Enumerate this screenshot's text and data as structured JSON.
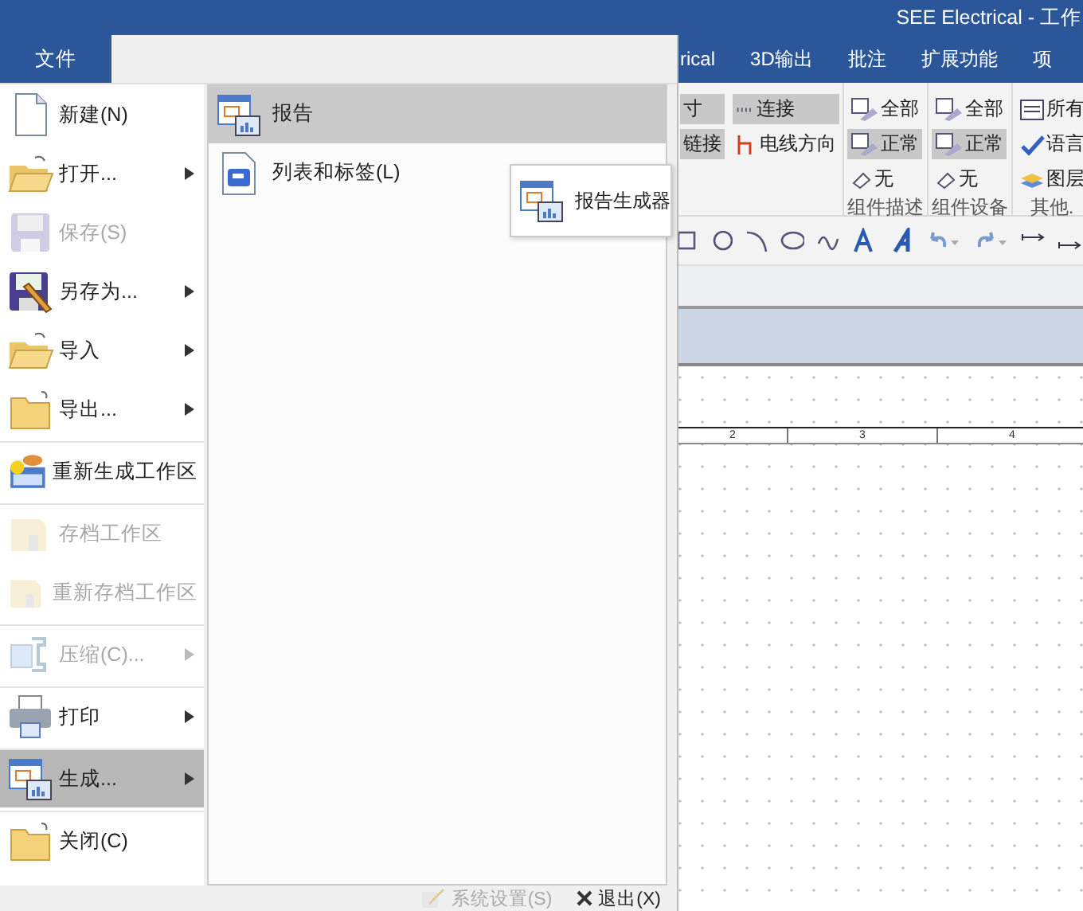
{
  "window": {
    "title": "SEE Electrical - 工作"
  },
  "ribbon_tabs": [
    {
      "label": "rical"
    },
    {
      "label": "3D输出"
    },
    {
      "label": "批注"
    },
    {
      "label": "扩展功能"
    },
    {
      "label": "项"
    }
  ],
  "ribbon_groups": [
    {
      "columns": [
        [
          {
            "label": "寸",
            "selected": true
          },
          {
            "label": "链接",
            "selected": true
          }
        ],
        [
          {
            "label": "连接",
            "selected": true
          },
          {
            "label": "电线方向",
            "selected": false
          }
        ]
      ]
    },
    {
      "label": "组件描述",
      "columns": [
        [
          {
            "label": "全部",
            "selected": false
          },
          {
            "label": "正常",
            "selected": true
          },
          {
            "label": "无",
            "selected": false
          }
        ]
      ]
    },
    {
      "label": "组件设备",
      "columns": [
        [
          {
            "label": "全部",
            "selected": false
          },
          {
            "label": "正常",
            "selected": true
          },
          {
            "label": "无",
            "selected": false
          }
        ]
      ]
    },
    {
      "label": "其他.",
      "columns": [
        [
          {
            "label": "所有",
            "selected": false
          },
          {
            "label": "语言",
            "selected": false
          },
          {
            "label": "图层",
            "selected": false
          }
        ]
      ]
    }
  ],
  "ruler": [
    "2",
    "3",
    "4"
  ],
  "file_menu": {
    "tab": "文件",
    "items": [
      {
        "label": "新建(N)",
        "disabled": false,
        "submenu": false,
        "selected": false,
        "separator_before": false
      },
      {
        "label": "打开...",
        "disabled": false,
        "submenu": true,
        "selected": false,
        "separator_before": false
      },
      {
        "label": "保存(S)",
        "disabled": true,
        "submenu": false,
        "selected": false,
        "separator_before": false
      },
      {
        "label": "另存为...",
        "disabled": false,
        "submenu": true,
        "selected": false,
        "separator_before": false
      },
      {
        "label": "导入",
        "disabled": false,
        "submenu": true,
        "selected": false,
        "separator_before": false
      },
      {
        "label": "导出...",
        "disabled": false,
        "submenu": true,
        "selected": false,
        "separator_before": false
      },
      {
        "label": "重新生成工作区",
        "disabled": false,
        "submenu": false,
        "selected": false,
        "separator_before": true
      },
      {
        "label": "存档工作区",
        "disabled": true,
        "submenu": false,
        "selected": false,
        "separator_before": true
      },
      {
        "label": "重新存档工作区",
        "disabled": true,
        "submenu": false,
        "selected": false,
        "separator_before": false
      },
      {
        "label": "压缩(C)...",
        "disabled": true,
        "submenu": true,
        "selected": false,
        "separator_before": true
      },
      {
        "label": "打印",
        "disabled": false,
        "submenu": true,
        "selected": false,
        "separator_before": true
      },
      {
        "label": "生成...",
        "disabled": false,
        "submenu": true,
        "selected": true,
        "separator_before": true
      },
      {
        "label": "关闭(C)",
        "disabled": false,
        "submenu": false,
        "selected": false,
        "separator_before": true
      }
    ],
    "submenu": [
      {
        "label": "报告",
        "selected": true
      },
      {
        "label": "列表和标签(L)",
        "selected": false
      }
    ],
    "flyout": [
      {
        "label": "报告生成器"
      }
    ],
    "footer": [
      {
        "label": "系统设置(S)",
        "disabled": true
      },
      {
        "label": "退出(X)",
        "disabled": false
      }
    ]
  }
}
